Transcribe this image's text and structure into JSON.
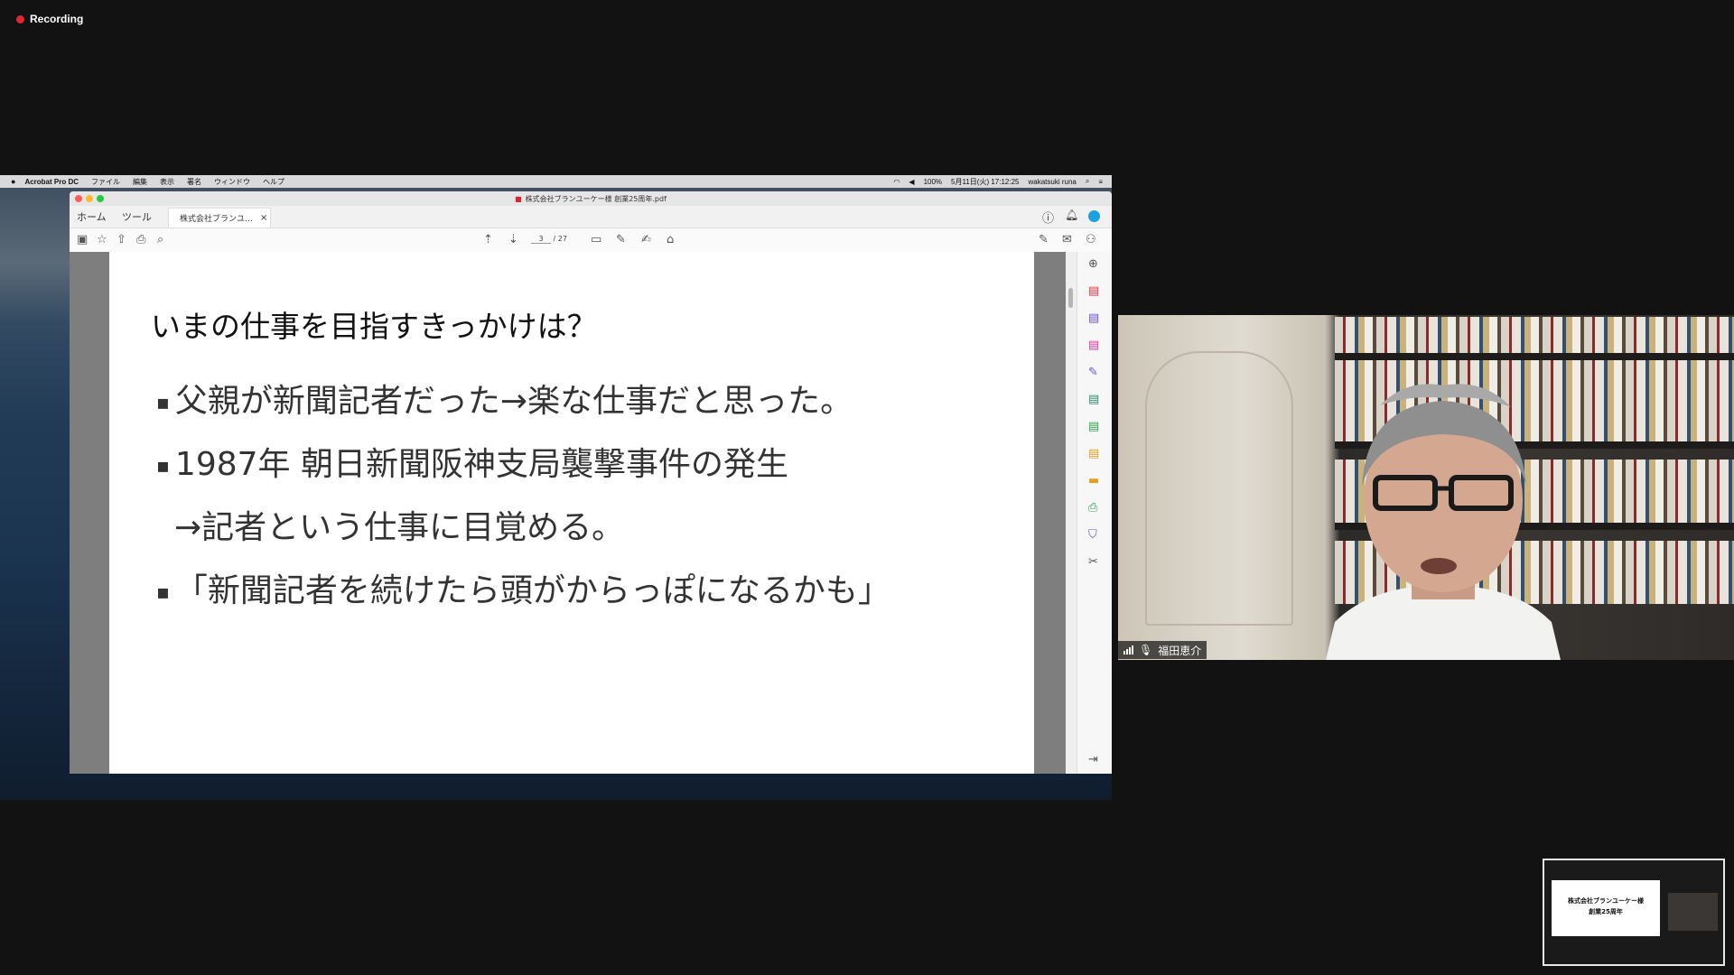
{
  "recording": {
    "label": "Recording"
  },
  "menubar": {
    "app_name": "Acrobat Pro DC",
    "items": [
      "ファイル",
      "編集",
      "表示",
      "署名",
      "ウィンドウ",
      "ヘルプ"
    ],
    "battery": "100%",
    "datetime": "5月11日(火)  17:12:25",
    "user": "wakatsuki runa"
  },
  "acrobat": {
    "window_title": "株式会社ブランユーケー様 創業25周年.pdf",
    "tabs": {
      "home": "ホーム",
      "tools": "ツール",
      "document": "株式会社ブランユ…"
    },
    "page_current": "3",
    "page_total": "/ 27"
  },
  "slide": {
    "title": "いまの仕事を目指すきっかけは？",
    "bullets": [
      "父親が新聞記者だった→楽な仕事だと思った。",
      "1987年 朝日新聞阪神支局襲撃事件の発生",
      "→記者という仕事に目覚める。",
      "「新聞記者を続けたら頭がからっぽになるかも」"
    ]
  },
  "video": {
    "participant_name": "福田恵介"
  },
  "self_preview": {
    "slide_title": "株式会社ブランユーケー様",
    "slide_subtitle": "創業25周年"
  },
  "colors": {
    "recording_dot": "#e3262f",
    "background": "#121212"
  },
  "icons": {
    "help": "help-icon",
    "bell": "bell-icon",
    "save": "save-icon",
    "star": "star-icon",
    "upload": "upload-icon",
    "print": "print-icon",
    "zoom": "zoom-icon",
    "up": "arrow-up-icon",
    "down": "arrow-down-icon",
    "comment": "comment-icon",
    "pen": "pen-icon",
    "sign": "sign-icon",
    "stamp": "stamp-icon",
    "mail": "mail-icon",
    "share": "share-icon"
  }
}
